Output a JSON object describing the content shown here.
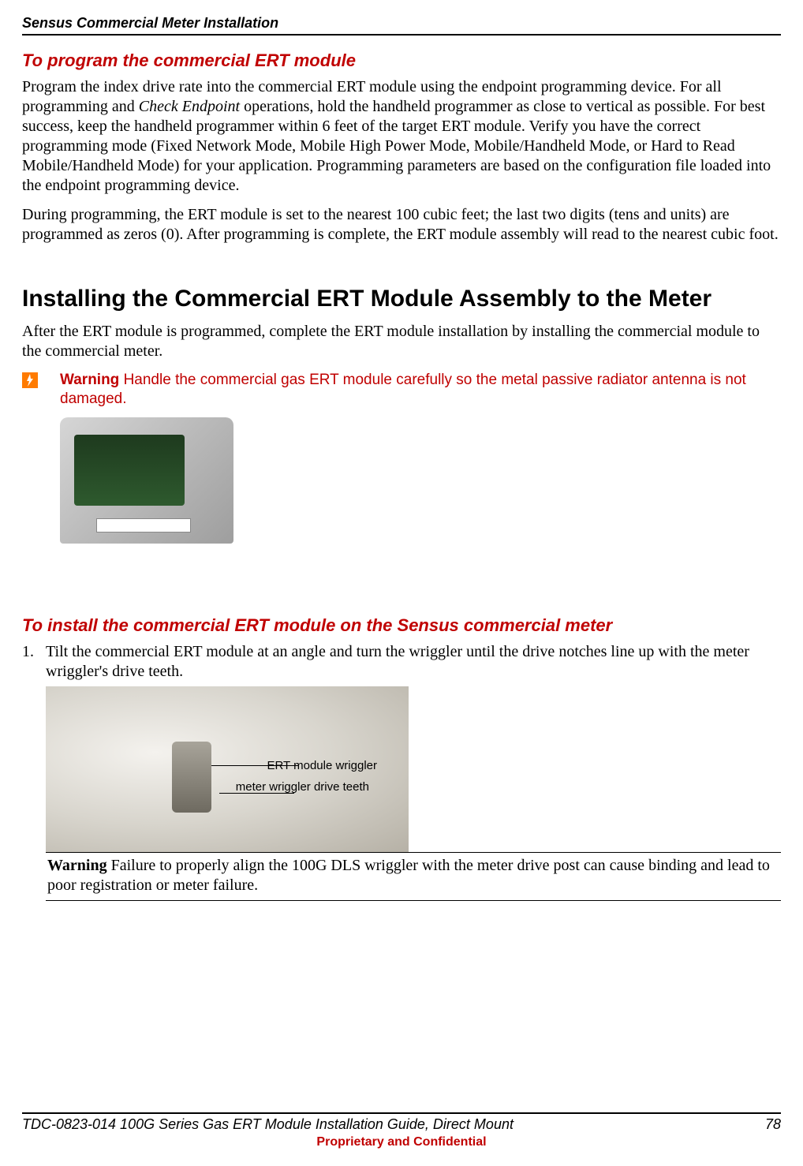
{
  "header": "Sensus Commercial Meter Installation",
  "sec1_title": "To program the commercial ERT module",
  "sec1_p1a": "Program the index drive rate into the commercial ERT module using the endpoint programming device. For all programming and ",
  "sec1_p1_em": "Check Endpoint",
  "sec1_p1b": " operations, hold the handheld programmer as close to vertical as possible. For best success, keep the handheld programmer within 6 feet of the target ERT module. Verify you have the correct programming mode (Fixed Network Mode, Mobile High Power Mode, Mobile/Handheld Mode, or Hard to Read Mobile/Handheld Mode) for your application. Programming parameters are based on the configuration file loaded into the endpoint programming device.",
  "sec1_p2": "During programming, the ERT module is set to the nearest 100 cubic feet; the last two digits (tens and units) are programmed as zeros (0). After programming is complete, the ERT module assembly will read to the nearest cubic foot.",
  "h2": "Installing the Commercial ERT Module Assembly to the Meter",
  "h2_p1": "After the ERT module is programmed, complete the ERT module installation by installing the commercial module to the commercial meter.",
  "warning_label": "Warning",
  "warning_text": "  Handle the commercial gas ERT module carefully so the metal passive radiator antenna is not damaged.",
  "sec2_title": "To install the commercial ERT module on the Sensus commercial meter",
  "step1_num": "1.",
  "step1_text": "Tilt the commercial ERT module at an angle and turn the wriggler until the drive notches line up with the meter wriggler's drive teeth.",
  "callout1": "ERT module wriggler",
  "callout2": "meter wriggler drive teeth",
  "inline_warn_label": "Warning",
  "inline_warn_text": "  Failure to properly align the 100G DLS wriggler with the meter drive post can cause binding and lead to poor registration or meter failure.",
  "footer_left": "TDC-0823-014 100G Series Gas ERT Module Installation Guide, Direct Mount",
  "footer_right": "78",
  "footer_sub": "Proprietary and Confidential"
}
